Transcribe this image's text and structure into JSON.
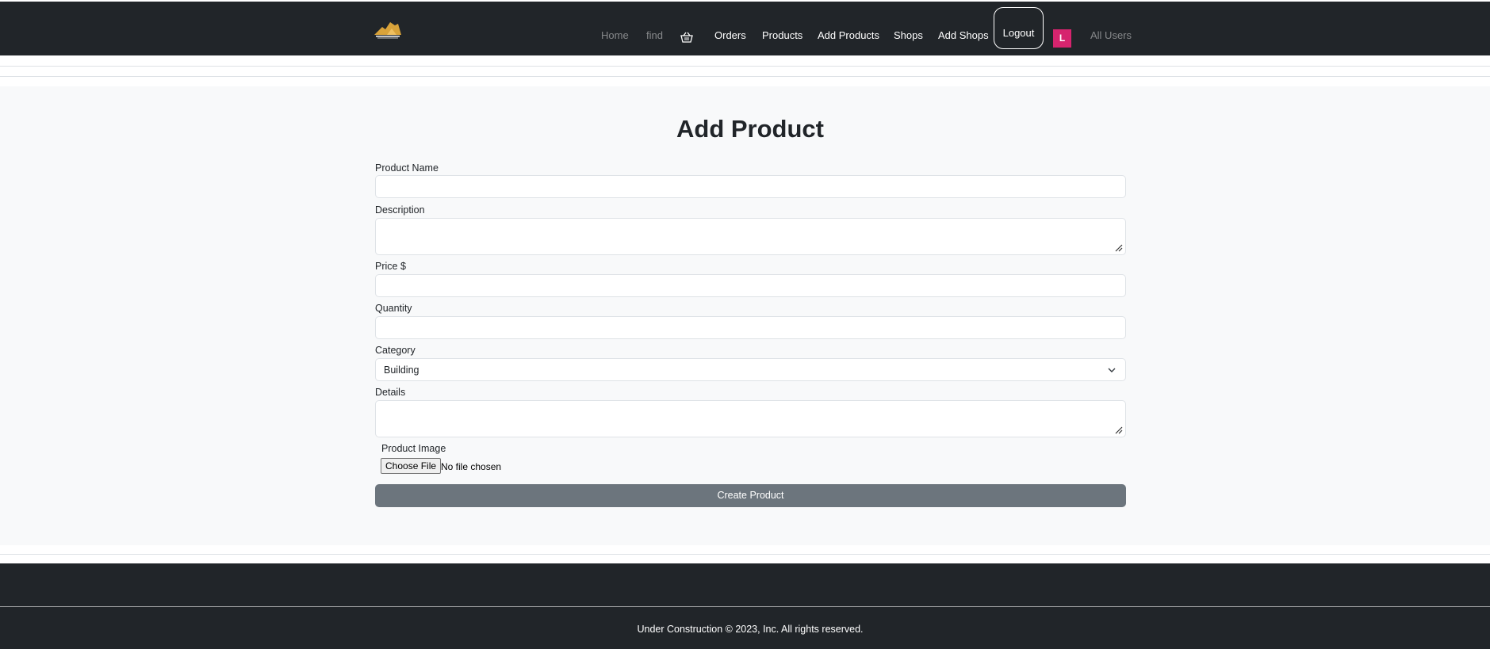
{
  "nav": {
    "items": [
      {
        "label": "Home"
      },
      {
        "label": "find"
      },
      {
        "label": "Orders"
      },
      {
        "label": "Products"
      },
      {
        "label": "Add Products"
      },
      {
        "label": "Shops"
      },
      {
        "label": "Add Shops"
      }
    ],
    "logout_label": "Logout",
    "avatar_initial": "L",
    "all_users_label": "All Users",
    "avatar_color": "#d6246e"
  },
  "main": {
    "title": "Add Product",
    "fields": {
      "product_name": {
        "label": "Product Name",
        "value": ""
      },
      "description": {
        "label": "Description",
        "value": ""
      },
      "price": {
        "label": "Price $",
        "value": ""
      },
      "quantity": {
        "label": "Quantity",
        "value": ""
      },
      "category": {
        "label": "Category",
        "selected": "Building"
      },
      "details": {
        "label": "Details",
        "value": ""
      },
      "image": {
        "label": "Product Image",
        "button_label": "Choose File",
        "status": "No file chosen"
      }
    },
    "submit_label": "Create Product"
  },
  "footer": {
    "text": "Under Construction © 2023, Inc. All rights reserved."
  },
  "colors": {
    "navbar_bg": "#212529",
    "page_bg": "#f8f9fa",
    "submit_bg": "#6c757d"
  }
}
